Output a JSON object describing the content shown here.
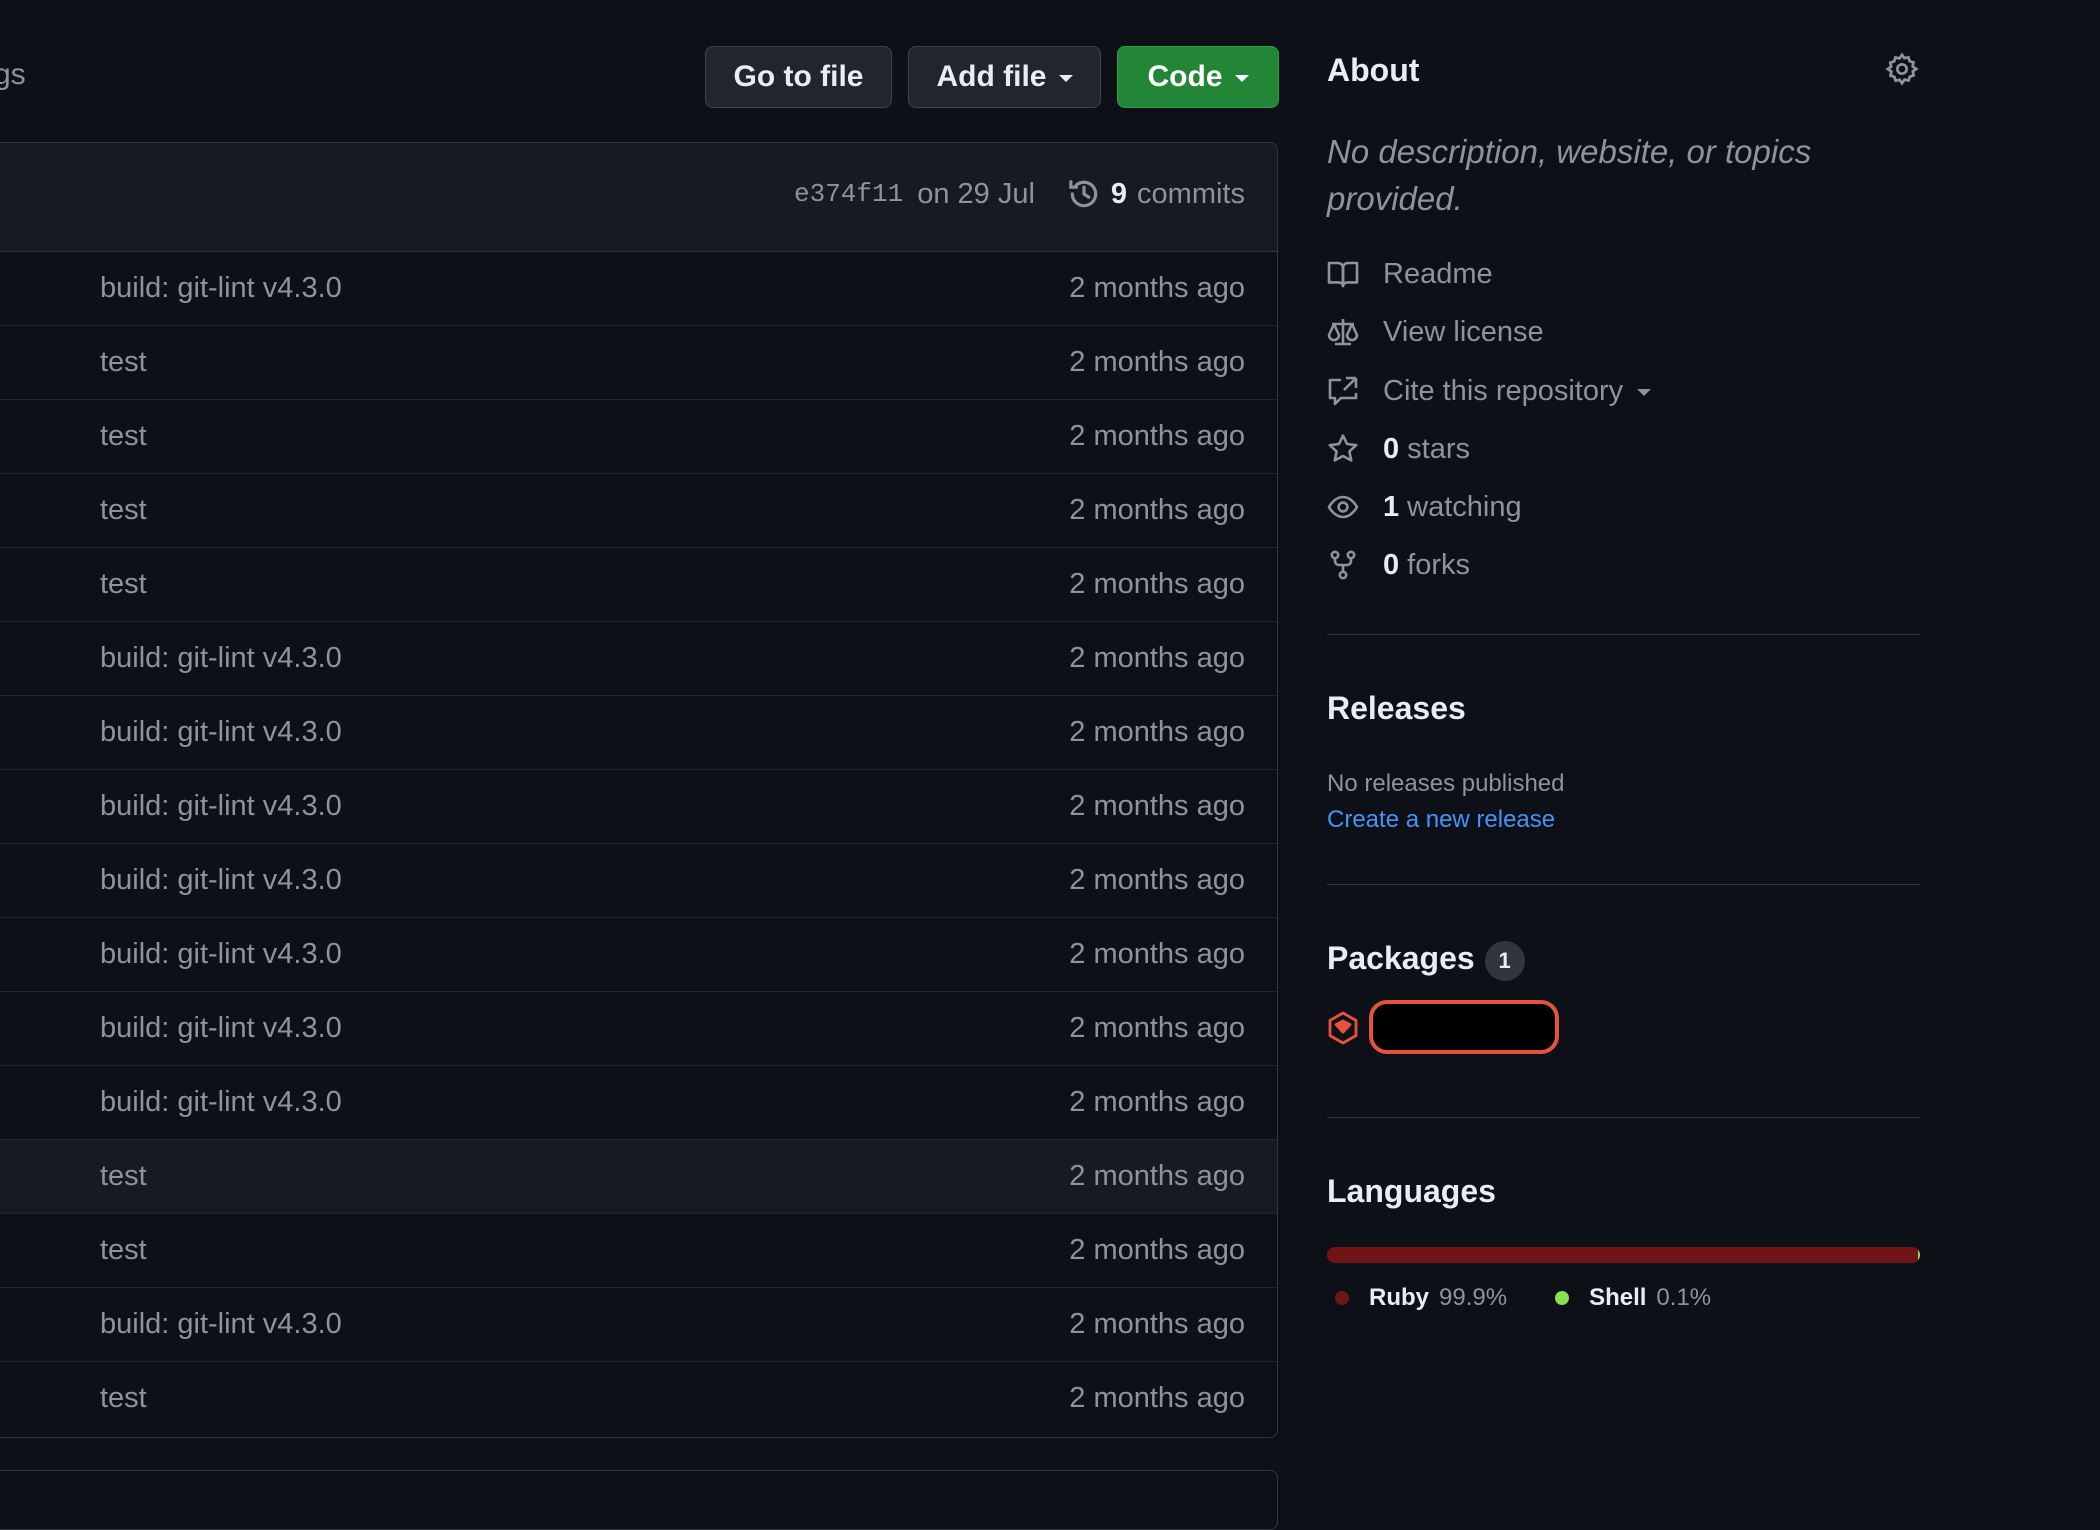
{
  "top": {
    "left_tag_fragment": "gs",
    "go_to_file": "Go to file",
    "add_file": "Add file",
    "code": "Code"
  },
  "file_header": {
    "sha": "e374f11",
    "date": "on 29 Jul",
    "commit_count": "9",
    "commits_label": "commits"
  },
  "rows": [
    {
      "message": "build: git-lint v4.3.0",
      "age": "2 months ago"
    },
    {
      "message": "test",
      "age": "2 months ago"
    },
    {
      "message": "test",
      "age": "2 months ago"
    },
    {
      "message": "test",
      "age": "2 months ago"
    },
    {
      "message": "test",
      "age": "2 months ago"
    },
    {
      "message": "build: git-lint v4.3.0",
      "age": "2 months ago"
    },
    {
      "message": "build: git-lint v4.3.0",
      "age": "2 months ago"
    },
    {
      "message": "build: git-lint v4.3.0",
      "age": "2 months ago"
    },
    {
      "message": "build: git-lint v4.3.0",
      "age": "2 months ago"
    },
    {
      "message": "build: git-lint v4.3.0",
      "age": "2 months ago"
    },
    {
      "message": "build: git-lint v4.3.0",
      "age": "2 months ago"
    },
    {
      "message": "build: git-lint v4.3.0",
      "age": "2 months ago"
    },
    {
      "message": "test",
      "age": "2 months ago"
    },
    {
      "message": "test",
      "age": "2 months ago"
    },
    {
      "message": "build: git-lint v4.3.0",
      "age": "2 months ago"
    },
    {
      "message": "test",
      "age": "2 months ago"
    }
  ],
  "about": {
    "title": "About",
    "description": "No description, website, or topics provided.",
    "readme": "Readme",
    "license": "View license",
    "cite": "Cite this repository",
    "stars_count": "0",
    "stars_label": "stars",
    "watching_count": "1",
    "watching_label": "watching",
    "forks_count": "0",
    "forks_label": "forks"
  },
  "releases": {
    "title": "Releases",
    "none": "No releases published",
    "create": "Create a new release"
  },
  "packages": {
    "title": "Packages",
    "count": "1"
  },
  "languages": {
    "title": "Languages",
    "items": [
      {
        "name": "Ruby",
        "percent": "99.9%",
        "value": 99.9,
        "color": "#701516"
      },
      {
        "name": "Shell",
        "percent": "0.1%",
        "value": 0.1,
        "color": "#89e051"
      }
    ]
  },
  "colors": {
    "background": "#0d1117",
    "code_button": "#238636",
    "link": "#4493f8",
    "package_highlight": "#e5533d"
  }
}
